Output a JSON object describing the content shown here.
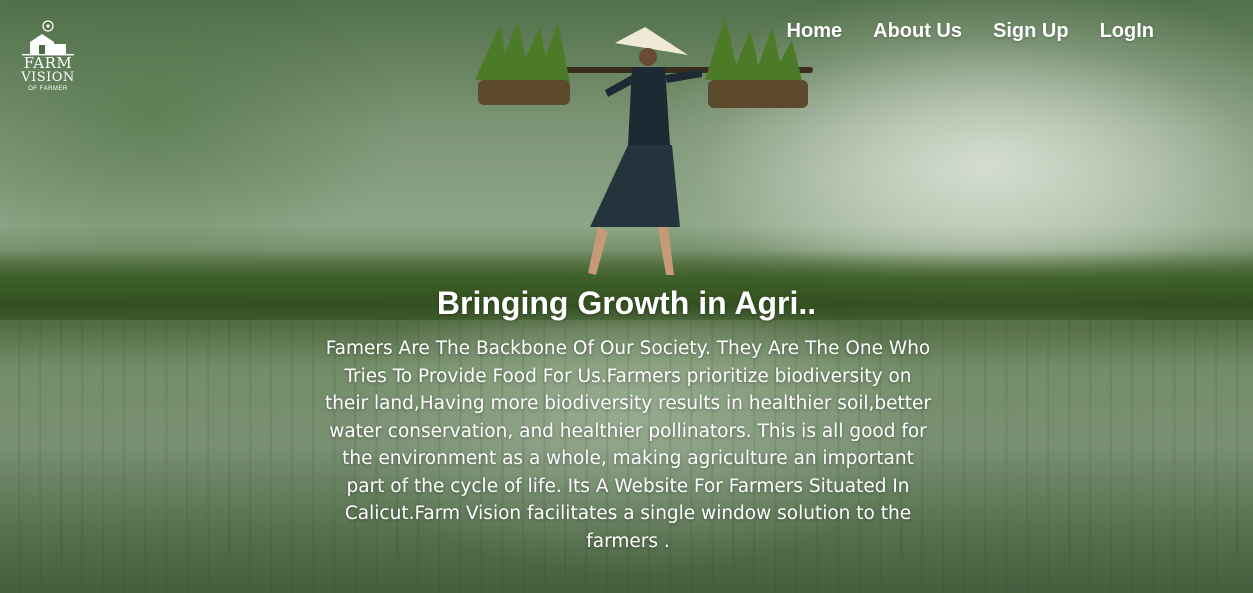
{
  "brand": {
    "logo_word1": "FARM",
    "logo_word2": "VISION",
    "logo_tagline": "OF FARMER"
  },
  "nav": {
    "items": [
      {
        "label": "Home"
      },
      {
        "label": "About Us"
      },
      {
        "label": "Sign Up"
      },
      {
        "label": "LogIn"
      }
    ]
  },
  "hero": {
    "title": "Bringing Growth in Agri..",
    "description": "Famers Are The Backbone Of Our Society. They Are The One Who Tries To Provide Food For Us.Farmers prioritize biodiversity on their land,Having more biodiversity results in healthier soil,better water conservation, and healthier pollinators. This is all good for the environment as a whole, making agriculture an important part of the cycle of life. Its A Website For Farmers Situated In Calicut.Farm Vision facilitates a single window solution to the farmers ."
  },
  "colors": {
    "text": "#ffffff",
    "field_green": "#4e6b3d",
    "mist": "#dfe6da"
  },
  "icons": {
    "logo": "farm-logo-icon"
  }
}
